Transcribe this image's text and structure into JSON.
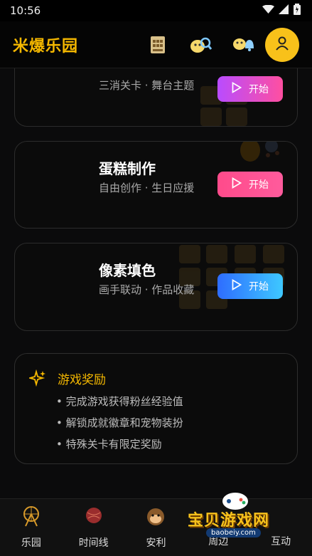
{
  "status": {
    "time": "10:56"
  },
  "header": {
    "title": "米爆乐园"
  },
  "cards": [
    {
      "title_partial": "",
      "desc": "三消关卡 · 舞台主题",
      "button": "开始",
      "gradient": [
        "#b94cff",
        "#ff4fa0"
      ]
    },
    {
      "title": "蛋糕制作",
      "desc": "自由创作 · 生日应援",
      "button": "开始",
      "gradient": [
        "#ff4b8b",
        "#ff5b9c"
      ]
    },
    {
      "title": "像素填色",
      "desc": "画手联动 · 作品收藏",
      "button": "开始",
      "gradient": [
        "#2e6dff",
        "#3ec8ff"
      ]
    }
  ],
  "reward": {
    "title": "游戏奖励",
    "items": [
      "• 完成游戏获得粉丝经验值",
      "• 解锁成就徽章和宠物装扮",
      "• 特殊关卡有限定奖励"
    ]
  },
  "nav": {
    "items": [
      "乐园",
      "时间线",
      "安利",
      "周边",
      "互动"
    ]
  },
  "watermark": {
    "title": "宝贝游戏网",
    "site": "baobeiy.com"
  },
  "colors": {
    "accent": "#f5b800",
    "card_border": "#2c2c2c"
  }
}
